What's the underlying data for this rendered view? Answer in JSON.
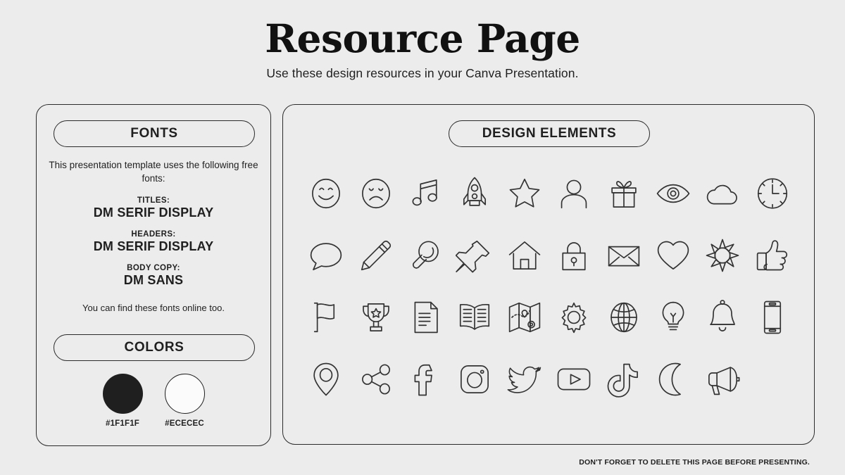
{
  "header": {
    "title": "Resource Page",
    "subtitle": "Use these design resources in your Canva Presentation."
  },
  "fonts_panel": {
    "pill_label": "FONTS",
    "intro": "This presentation template uses the following free fonts:",
    "entries": [
      {
        "label": "TITLES:",
        "value": "DM SERIF DISPLAY"
      },
      {
        "label": "HEADERS:",
        "value": "DM SERIF DISPLAY"
      },
      {
        "label": "BODY COPY:",
        "value": "DM SANS"
      }
    ],
    "outro": "You can find these fonts online too."
  },
  "colors_panel": {
    "pill_label": "COLORS",
    "swatches": [
      {
        "hex": "#1F1F1F",
        "label": "#1F1F1F",
        "style": "dark"
      },
      {
        "hex": "#ECECEC",
        "label": "#ECECEC",
        "style": "light"
      }
    ]
  },
  "elements_panel": {
    "pill_label": "DESIGN ELEMENTS",
    "columns": 10,
    "rows": 4,
    "icons": [
      "smile-icon",
      "frown-icon",
      "music-note-icon",
      "rocket-icon",
      "star-icon",
      "person-icon",
      "gift-icon",
      "eye-icon",
      "cloud-icon",
      "clock-icon",
      "speech-bubble-icon",
      "pencil-icon",
      "magnifier-icon",
      "pushpin-icon",
      "house-icon",
      "lock-icon",
      "envelope-icon",
      "heart-icon",
      "sun-icon",
      "thumbs-up-icon",
      "flag-icon",
      "trophy-icon",
      "document-icon",
      "book-icon",
      "map-icon",
      "gear-icon",
      "globe-icon",
      "lightbulb-icon",
      "bell-icon",
      "phone-icon",
      "location-pin-icon",
      "share-icon",
      "facebook-icon",
      "instagram-icon",
      "twitter-icon",
      "youtube-icon",
      "tiktok-icon",
      "moon-icon",
      "megaphone-icon"
    ]
  },
  "footer": {
    "note": "DON'T FORGET TO DELETE THIS PAGE BEFORE PRESENTING."
  }
}
